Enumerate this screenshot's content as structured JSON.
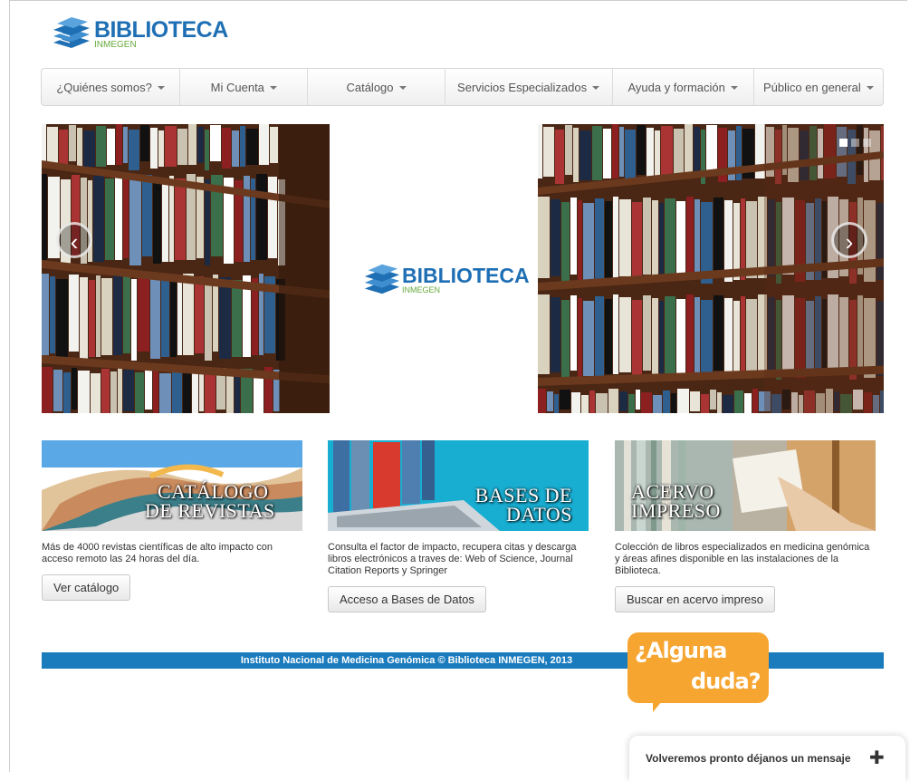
{
  "brand": {
    "title": "BIBLIOTECA",
    "subtitle": "INMEGEN",
    "color": "#1f6fb4",
    "accent": "#66a93c"
  },
  "nav": {
    "items": [
      {
        "label": "¿Quiénes somos?"
      },
      {
        "label": "Mi Cuenta"
      },
      {
        "label": "Catálogo"
      },
      {
        "label": "Servicios Especializados"
      },
      {
        "label": "Ayuda y formación"
      },
      {
        "label": "Público en general"
      }
    ]
  },
  "carousel": {
    "logo_title": "BIBLIOTECA",
    "logo_subtitle": "INMEGEN",
    "prev_icon": "chevron-left-icon",
    "next_icon": "chevron-right-icon",
    "prev_glyph": "‹",
    "next_glyph": "›",
    "slides": 3,
    "active_slide": 1
  },
  "features": [
    {
      "banner_line1": "CATÁLOGO",
      "banner_line2": "DE REVISTAS",
      "description": "Más de 4000 revistas científicas de alto impacto con acceso remoto las 24 horas del día.",
      "button": "Ver catálogo"
    },
    {
      "banner_line1": "BASES DE",
      "banner_line2": "DATOS",
      "description": "Consulta el factor de impacto, recupera citas y descarga libros electrónicos a traves de: Web of Science, Journal Citation Reports y Springer",
      "button": "Acceso a Bases de Datos"
    },
    {
      "banner_line1": "ACERVO",
      "banner_line2": "IMPRESO",
      "description": "Colección de libros especializados en medicina genómica y áreas afines disponible en las instalaciones de la Biblioteca.",
      "button": "Buscar en acervo impreso"
    }
  ],
  "footer": {
    "text": "Instituto Nacional de Medicina Genómica © Biblioteca INMEGEN, 2013",
    "color": "#1a7bbd"
  },
  "help_bubble": {
    "line1": "¿Alguna",
    "line2": "duda?",
    "color": "#f7a531"
  },
  "chat": {
    "label": "Volveremos pronto déjanos un mensaje",
    "icon": "plus-icon",
    "glyph": "✚"
  }
}
